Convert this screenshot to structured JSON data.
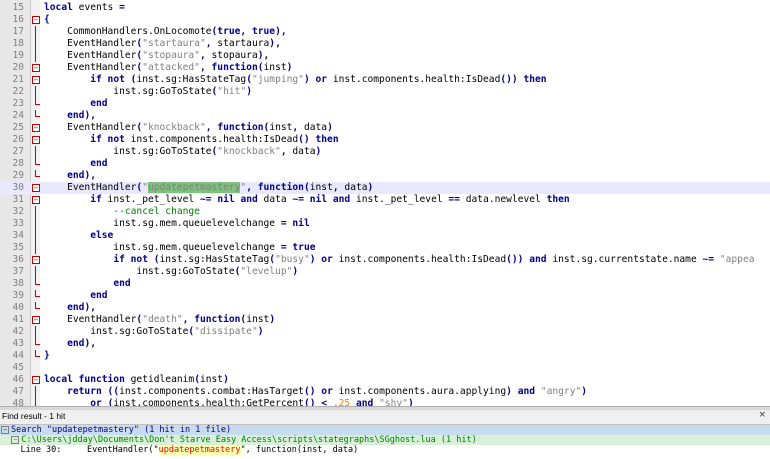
{
  "editor": {
    "lines": [
      {
        "n": "15",
        "fold": "",
        "html": "<span class=\"kw\">local</span> events <span class=\"op\">=</span>"
      },
      {
        "n": "16",
        "fold": "open",
        "html": "<span class=\"op\">{</span>"
      },
      {
        "n": "17",
        "fold": "line",
        "html": "    CommonHandlers.OnLocomote<span class=\"op\">(</span><span class=\"kw\">true</span><span class=\"op\">,</span> <span class=\"kw\">true</span><span class=\"op\">),</span>"
      },
      {
        "n": "18",
        "fold": "line",
        "html": "    EventHandler<span class=\"op\">(</span><span class=\"str\">\"startaura\"</span><span class=\"op\">,</span> startaura<span class=\"op\">),</span>"
      },
      {
        "n": "19",
        "fold": "line",
        "html": "    EventHandler<span class=\"op\">(</span><span class=\"str\">\"stopaura\"</span><span class=\"op\">,</span> stopaura<span class=\"op\">),</span>"
      },
      {
        "n": "20",
        "fold": "open",
        "html": "    EventHandler<span class=\"op\">(</span><span class=\"str\">\"attacked\"</span><span class=\"op\">,</span> <span class=\"kw\">function</span><span class=\"op\">(</span>inst<span class=\"op\">)</span>"
      },
      {
        "n": "21",
        "fold": "open",
        "html": "        <span class=\"kw\">if not</span> <span class=\"op\">(</span>inst.sg:HasStateTag<span class=\"op\">(</span><span class=\"str\">\"jumping\"</span><span class=\"op\">)</span> <span class=\"kw\">or</span> inst.components.health:IsDead<span class=\"op\">())</span> <span class=\"kw\">then</span>"
      },
      {
        "n": "22",
        "fold": "line",
        "html": "            inst.sg:GoToState<span class=\"op\">(</span><span class=\"str\">\"hit\"</span><span class=\"op\">)</span>"
      },
      {
        "n": "23",
        "fold": "end",
        "html": "        <span class=\"kw\">end</span>"
      },
      {
        "n": "24",
        "fold": "end",
        "html": "    <span class=\"kw\">end</span><span class=\"op\">),</span>"
      },
      {
        "n": "25",
        "fold": "open",
        "html": "    EventHandler<span class=\"op\">(</span><span class=\"str\">\"knockback\"</span><span class=\"op\">,</span> <span class=\"kw\">function</span><span class=\"op\">(</span>inst<span class=\"op\">,</span> data<span class=\"op\">)</span>"
      },
      {
        "n": "26",
        "fold": "open",
        "html": "        <span class=\"kw\">if not</span> inst.components.health:IsDead<span class=\"op\">()</span> <span class=\"kw\">then</span>"
      },
      {
        "n": "27",
        "fold": "line",
        "html": "            inst.sg:GoToState<span class=\"op\">(</span><span class=\"str\">\"knockback\"</span><span class=\"op\">,</span> data<span class=\"op\">)</span>"
      },
      {
        "n": "28",
        "fold": "end",
        "html": "        <span class=\"kw\">end</span>"
      },
      {
        "n": "29",
        "fold": "end",
        "html": "    <span class=\"kw\">end</span><span class=\"op\">),</span>"
      },
      {
        "n": "30",
        "fold": "open",
        "hl": true,
        "html": "    EventHandler<span class=\"op\">(</span><span class=\"str\">\"</span><span class=\"match\">updatepetmastery</span><span class=\"str\">\"</span><span class=\"op\">,</span> <span class=\"kw\">function</span><span class=\"op\">(</span>inst<span class=\"op\">,</span> data<span class=\"op\">)</span>"
      },
      {
        "n": "31",
        "fold": "open",
        "html": "        <span class=\"kw\">if</span> inst._pet_level <span class=\"op\">~=</span> <span class=\"kw\">nil</span> <span class=\"kw\">and</span> data <span class=\"op\">~=</span> <span class=\"kw\">nil</span> <span class=\"kw\">and</span> inst._pet_level <span class=\"op\">==</span> data.newlevel <span class=\"kw\">then</span>"
      },
      {
        "n": "32",
        "fold": "line",
        "html": "            <span class=\"cmt\">--cancel change</span>"
      },
      {
        "n": "33",
        "fold": "line",
        "html": "            inst.sg.mem.queuelevelchange <span class=\"op\">=</span> <span class=\"kw\">nil</span>"
      },
      {
        "n": "34",
        "fold": "line",
        "html": "        <span class=\"kw\">else</span>"
      },
      {
        "n": "35",
        "fold": "line",
        "html": "            inst.sg.mem.queuelevelchange <span class=\"op\">=</span> <span class=\"kw\">true</span>"
      },
      {
        "n": "36",
        "fold": "open",
        "html": "            <span class=\"kw\">if not</span> <span class=\"op\">(</span>inst.sg:HasStateTag<span class=\"op\">(</span><span class=\"str\">\"busy\"</span><span class=\"op\">)</span> <span class=\"kw\">or</span> inst.components.health:IsDead<span class=\"op\">())</span> <span class=\"kw\">and</span> inst.sg.currentstate.name <span class=\"op\">~=</span> <span class=\"str\">\"appea</span>"
      },
      {
        "n": "37",
        "fold": "line",
        "html": "                inst.sg:GoToState<span class=\"op\">(</span><span class=\"str\">\"levelup\"</span><span class=\"op\">)</span>"
      },
      {
        "n": "38",
        "fold": "end",
        "html": "            <span class=\"kw\">end</span>"
      },
      {
        "n": "39",
        "fold": "end",
        "html": "        <span class=\"kw\">end</span>"
      },
      {
        "n": "40",
        "fold": "end",
        "html": "    <span class=\"kw\">end</span><span class=\"op\">),</span>"
      },
      {
        "n": "41",
        "fold": "open",
        "html": "    EventHandler<span class=\"op\">(</span><span class=\"str\">\"death\"</span><span class=\"op\">,</span> <span class=\"kw\">function</span><span class=\"op\">(</span>inst<span class=\"op\">)</span>"
      },
      {
        "n": "42",
        "fold": "line",
        "html": "        inst.sg:GoToState<span class=\"op\">(</span><span class=\"str\">\"dissipate\"</span><span class=\"op\">)</span>"
      },
      {
        "n": "43",
        "fold": "end",
        "html": "    <span class=\"kw\">end</span><span class=\"op\">),</span>"
      },
      {
        "n": "44",
        "fold": "end",
        "html": "<span class=\"op\">}</span>"
      },
      {
        "n": "45",
        "fold": "",
        "html": ""
      },
      {
        "n": "46",
        "fold": "open",
        "html": "<span class=\"kw\">local function</span> getidleanim<span class=\"op\">(</span>inst<span class=\"op\">)</span>"
      },
      {
        "n": "47",
        "fold": "line",
        "html": "    <span class=\"kw\">return</span> <span class=\"op\">((</span>inst.components.combat:HasTarget<span class=\"op\">()</span> <span class=\"kw\">or</span> inst.components.aura.applying<span class=\"op\">)</span> <span class=\"kw\">and</span> <span class=\"str\">\"angry\"</span><span class=\"op\">)</span>"
      },
      {
        "n": "48",
        "fold": "line",
        "html": "        <span class=\"kw\">or</span> <span class=\"op\">(</span>inst.components.health:GetPercent<span class=\"op\">()</span> <span class=\"op\">&lt;</span> <span class=\"num\">.25</span> <span class=\"kw\">and</span> <span class=\"str\">\"shy\"</span><span class=\"op\">)</span>"
      }
    ]
  },
  "find_panel": {
    "title": "Find result - 1 hit",
    "close": "×",
    "search_prefix": "Search \"",
    "search_term": "updatepetmastery",
    "search_suffix": "\" (1 hit in 1 file)",
    "file_path": "C:\\Users\\jdday\\Documents\\Don't Starve Easy Access\\scripts\\stategraphs\\SGghost.lua (1 hit)",
    "hit_prefix": "    Line 30:     EventHandler(\"",
    "hit_term": "updatepetmastery",
    "hit_suffix": "\", function(inst, data)"
  },
  "colors": {
    "match_highlight": "#80c080",
    "current_line": "#e8e8ff",
    "keyword": "#00008b",
    "string": "#808080",
    "comment": "#008000"
  }
}
